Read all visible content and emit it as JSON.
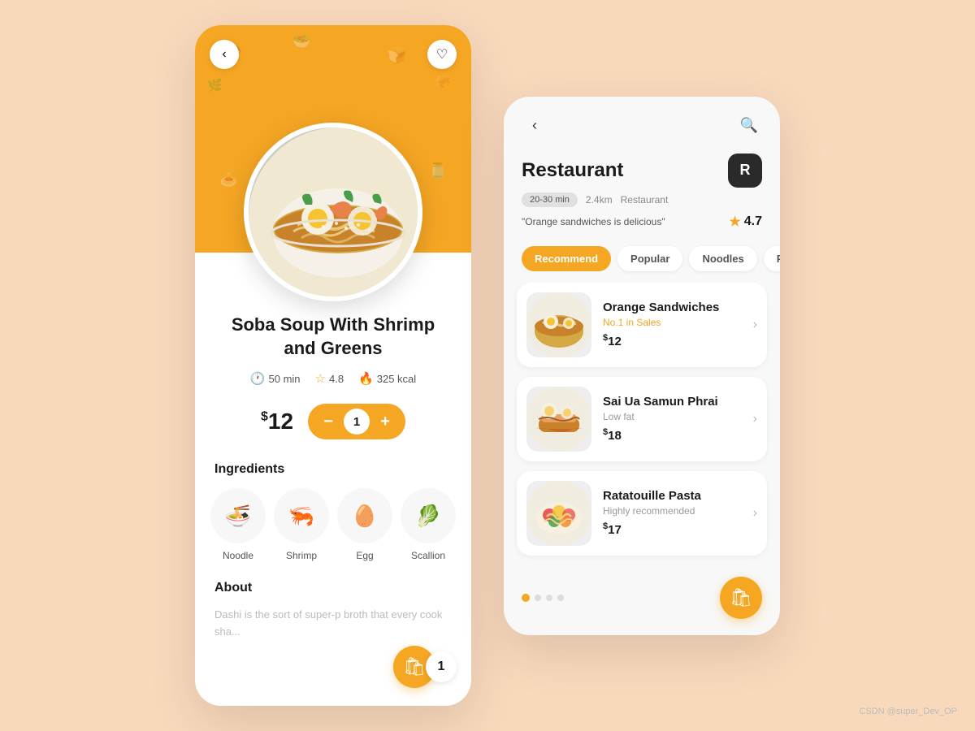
{
  "left_card": {
    "dish_title": "Soba Soup With Shrimp and Greens",
    "meta": {
      "time": "50 min",
      "rating": "4.8",
      "calories": "325 kcal"
    },
    "price": "12",
    "quantity": "1",
    "ingredients_title": "Ingredients",
    "ingredients": [
      {
        "name": "Noodle",
        "emoji": "🍜"
      },
      {
        "name": "Shrimp",
        "emoji": "🦐"
      },
      {
        "name": "Egg",
        "emoji": "🥚"
      },
      {
        "name": "Scallion",
        "emoji": "🥬"
      }
    ],
    "about_title": "About",
    "about_text": "Dashi is the sort of super-p broth that every cook sha...",
    "cart_count": "1",
    "back_label": "‹",
    "heart_label": "♡"
  },
  "right_card": {
    "back_label": "‹",
    "search_label": "🔍",
    "restaurant_name": "Restaurant",
    "logo_text": "R",
    "time_badge": "20-30 min",
    "distance": "2.4km",
    "type": "Restaurant",
    "quote": "\"Orange sandwiches is delicious\"",
    "rating": "4.7",
    "categories": [
      {
        "label": "Recommend",
        "active": true
      },
      {
        "label": "Popular",
        "active": false
      },
      {
        "label": "Noodles",
        "active": false
      },
      {
        "label": "Pizza",
        "active": false
      }
    ],
    "menu_items": [
      {
        "name": "Orange Sandwiches",
        "sub": "No.1 in Sales",
        "sub_style": "orange",
        "price": "12",
        "emoji": "🍜"
      },
      {
        "name": "Sai Ua Samun Phrai",
        "sub": "Low fat",
        "sub_style": "gray",
        "price": "18",
        "emoji": "🍗"
      },
      {
        "name": "Ratatouille Pasta",
        "sub": "Highly recommended",
        "sub_style": "gray",
        "price": "17",
        "emoji": "🥗"
      }
    ],
    "cart_icon": "🛍",
    "dots": [
      true,
      false,
      false,
      false
    ]
  },
  "watermark": "CSDN @super_Dev_OP"
}
